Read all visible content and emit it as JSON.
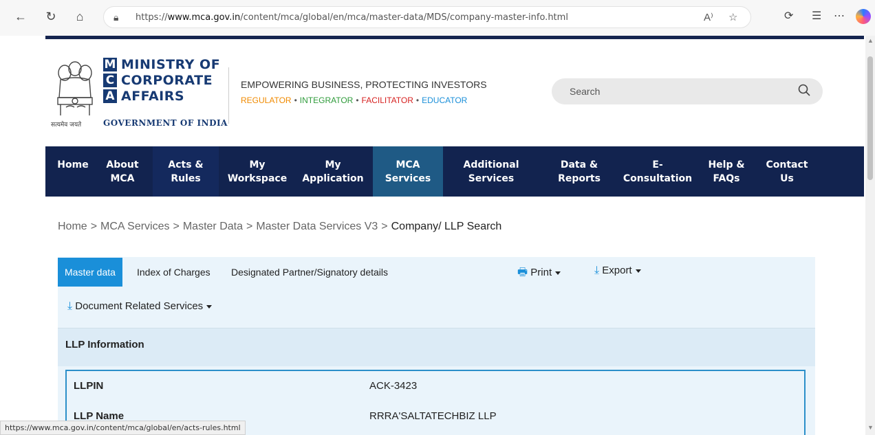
{
  "browser": {
    "url_prefix": "https://",
    "url_host": "www.mca.gov.in",
    "url_path": "/content/mca/global/en/mca/master-data/MDS/company-master-info.html",
    "status_url": "https://www.mca.gov.in/content/mca/global/en/acts-rules.html"
  },
  "header": {
    "logo_letters": [
      "M",
      "C",
      "A"
    ],
    "logo_words": [
      "MINISTRY OF",
      "CORPORATE",
      "AFFAIRS"
    ],
    "emblem_caption": "सत्यमेव जयते",
    "government": "GOVERNMENT OF INDIA",
    "tagline": "EMPOWERING BUSINESS, PROTECTING INVESTORS",
    "roles": [
      {
        "label": "REGULATOR",
        "color": "#f08a00"
      },
      {
        "label": "INTEGRATOR",
        "color": "#2e9b3a"
      },
      {
        "label": "FACILITATOR",
        "color": "#d6201f"
      },
      {
        "label": "EDUCATOR",
        "color": "#1a8fd9"
      }
    ],
    "search_placeholder": "Search"
  },
  "nav": {
    "items": [
      {
        "line1": "Home",
        "line2": ""
      },
      {
        "line1": "About",
        "line2": "MCA"
      },
      {
        "line1": "Acts &",
        "line2": "Rules"
      },
      {
        "line1": "My",
        "line2": "Workspace"
      },
      {
        "line1": "My",
        "line2": "Application"
      },
      {
        "line1": "MCA",
        "line2": "Services"
      },
      {
        "line1": "Additional",
        "line2": "Services"
      },
      {
        "line1": "Data &",
        "line2": "Reports"
      },
      {
        "line1": "E-",
        "line2": "Consultation"
      },
      {
        "line1": "Help &",
        "line2": "FAQs"
      },
      {
        "line1": "Contact",
        "line2": "Us"
      }
    ],
    "active_index": 5,
    "hover_index": 2
  },
  "breadcrumb": {
    "items": [
      "Home",
      "MCA Services",
      "Master Data",
      "Master Data Services V3",
      "Company/ LLP Search"
    ],
    "separator": ">"
  },
  "tabs": {
    "items": [
      "Master data",
      "Index of Charges",
      "Designated Partner/Signatory details"
    ],
    "active_index": 0
  },
  "toolbar": {
    "print_label": "Print",
    "export_label": "Export",
    "document_services_label": "Document Related Services"
  },
  "llp_info": {
    "section_title": "LLP Information",
    "fields": [
      {
        "label": "LLPIN",
        "value": "ACK-3423"
      },
      {
        "label": "LLP Name",
        "value": "RRRA'SALTATECHBIZ LLP"
      }
    ]
  },
  "colors": {
    "nav_bg": "#12234f",
    "nav_active": "#1f5a85",
    "accent": "#1a8fd9"
  }
}
